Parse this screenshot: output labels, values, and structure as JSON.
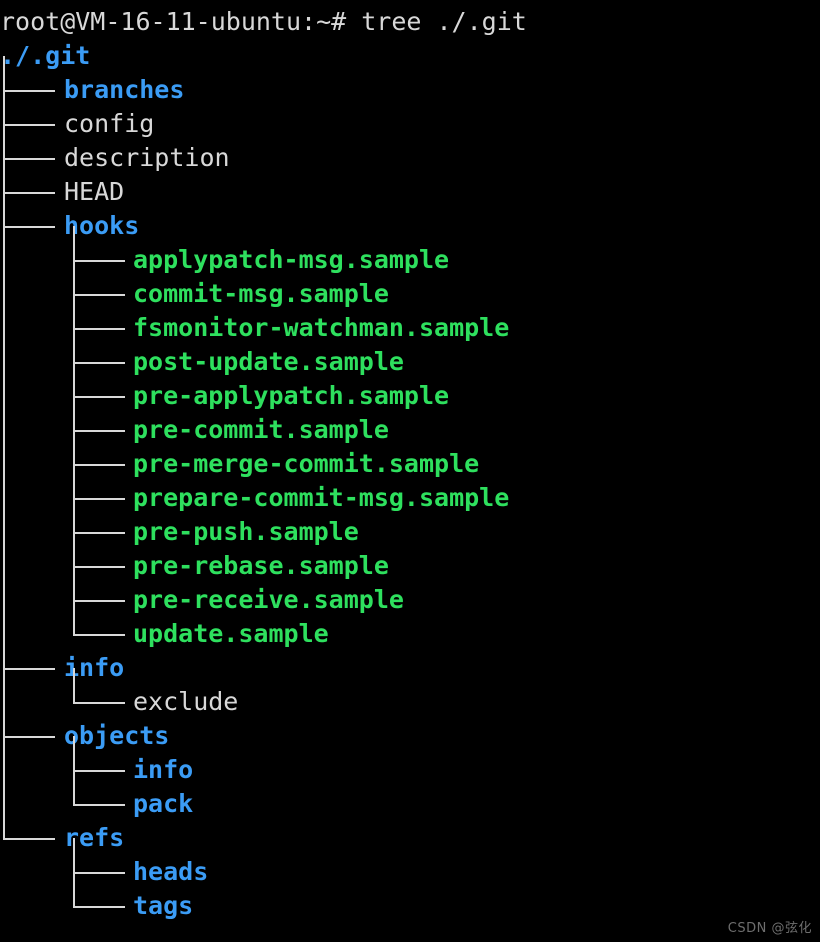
{
  "terminal": {
    "background_color": "#000000",
    "prompt_text": "root@VM-16-11-ubuntu:~# tree ./.git",
    "root_label": "./.git",
    "colors": {
      "directory": "#3b9cf5",
      "executable": "#2ee05e",
      "regular_file": "#d8d8d8",
      "guide_line": "#d8d8d8",
      "watermark": "#6e6e6e"
    }
  },
  "watermark": {
    "text": "CSDN @弦化"
  },
  "tree": {
    "entries": [
      {
        "name": "branches",
        "depth": 1,
        "type": "dir",
        "last": false
      },
      {
        "name": "config",
        "depth": 1,
        "type": "file",
        "last": false
      },
      {
        "name": "description",
        "depth": 1,
        "type": "file",
        "last": false
      },
      {
        "name": "HEAD",
        "depth": 1,
        "type": "file",
        "last": false
      },
      {
        "name": "hooks",
        "depth": 1,
        "type": "dir",
        "last": false
      },
      {
        "name": "applypatch-msg.sample",
        "depth": 2,
        "type": "exe",
        "last": false
      },
      {
        "name": "commit-msg.sample",
        "depth": 2,
        "type": "exe",
        "last": false
      },
      {
        "name": "fsmonitor-watchman.sample",
        "depth": 2,
        "type": "exe",
        "last": false
      },
      {
        "name": "post-update.sample",
        "depth": 2,
        "type": "exe",
        "last": false
      },
      {
        "name": "pre-applypatch.sample",
        "depth": 2,
        "type": "exe",
        "last": false
      },
      {
        "name": "pre-commit.sample",
        "depth": 2,
        "type": "exe",
        "last": false
      },
      {
        "name": "pre-merge-commit.sample",
        "depth": 2,
        "type": "exe",
        "last": false
      },
      {
        "name": "prepare-commit-msg.sample",
        "depth": 2,
        "type": "exe",
        "last": false
      },
      {
        "name": "pre-push.sample",
        "depth": 2,
        "type": "exe",
        "last": false
      },
      {
        "name": "pre-rebase.sample",
        "depth": 2,
        "type": "exe",
        "last": false
      },
      {
        "name": "pre-receive.sample",
        "depth": 2,
        "type": "exe",
        "last": false
      },
      {
        "name": "update.sample",
        "depth": 2,
        "type": "exe",
        "last": true
      },
      {
        "name": "info",
        "depth": 1,
        "type": "dir",
        "last": false
      },
      {
        "name": "exclude",
        "depth": 2,
        "type": "file",
        "last": true
      },
      {
        "name": "objects",
        "depth": 1,
        "type": "dir",
        "last": false
      },
      {
        "name": "info",
        "depth": 2,
        "type": "dir",
        "last": false
      },
      {
        "name": "pack",
        "depth": 2,
        "type": "dir",
        "last": true
      },
      {
        "name": "refs",
        "depth": 1,
        "type": "dir",
        "last": true
      },
      {
        "name": "heads",
        "depth": 2,
        "type": "dir",
        "last": false
      },
      {
        "name": "tags",
        "depth": 2,
        "type": "dir",
        "last": true
      }
    ]
  }
}
